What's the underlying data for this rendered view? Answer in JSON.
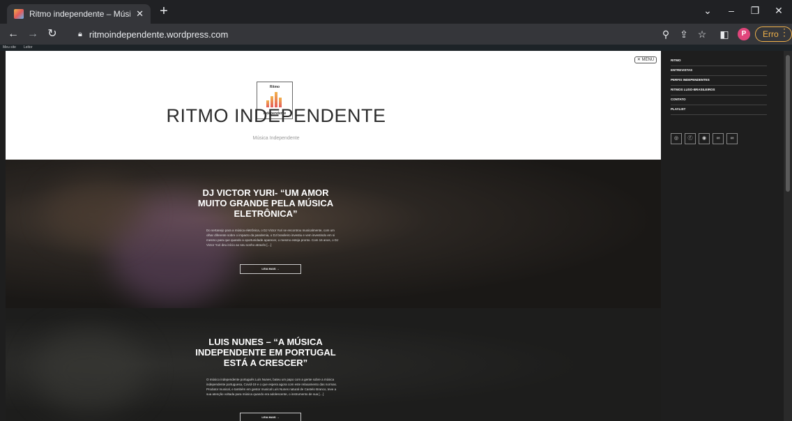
{
  "browser": {
    "tab_title": "Ritmo independente – Música In",
    "tab_close": "✕",
    "new_tab": "+",
    "url": "ritmoindependente.wordpress.com",
    "error_label": "Erro",
    "profile_initial": "P",
    "window_controls": {
      "tabs_menu": "⌄",
      "minimize": "–",
      "restore": "❐",
      "close": "✕"
    }
  },
  "wp_admin_bar": {
    "item1": "Meu site",
    "item2": "Leitor"
  },
  "site": {
    "title": "RITMO INDEPENDENTE",
    "tagline": "Música Independente",
    "logo_top": "Ritmo",
    "logo_bottom": "Independente",
    "menu_button": "✕ MENU"
  },
  "posts": [
    {
      "title": "DJ VICTOR YURI- “UM AMOR MUITO GRANDE PELA MÚSICA ELETRÔNICA”",
      "excerpt": "Do sertanejo para a música eletrônica, o DJ Victor Yuri se encontrou musicalmente, com um olhar diferente sobre o impacto da pandemia, o DJ brasileiro investiu e vem investindo em si mesmo para que quando a oportunidade aparecer, o mesmo esteja pronto. Com 16 anos, o DJ Victor Yuri deu início ao seu sonho através […]",
      "read_more": "LEIA MAIS →"
    },
    {
      "title": "LUIS NUNES – “A MÚSICA INDEPENDENTE EM PORTUGAL ESTÁ A CRESCER”",
      "excerpt": "O músico independente português Luís Nunes, bateu um papo com a gente sobre a música independente portuguesa, Covid-19 e o que espera agora com este relaxamento das normas. Produtor musical, e também em gestor musical Luís Nunes natural de Castelo Branco, teve a sua atenção voltada para música quando era adolescente, o instrumento de sua […]",
      "read_more": "LEIA MAIS →"
    }
  ],
  "side_menu": {
    "items": [
      "RITMO",
      "ENTREVISTAS",
      "PERFIS INDEPENDENTES",
      "RITMOS LUSO-BRASILEIROS",
      "CONTATO",
      "PLAYLIST"
    ],
    "social_icons": [
      "instagram-icon",
      "facebook-icon",
      "spotify-icon",
      "link-icon",
      "link-icon"
    ]
  }
}
